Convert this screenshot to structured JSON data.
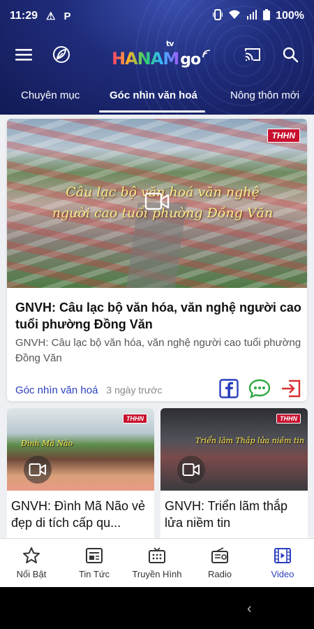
{
  "status_bar": {
    "time": "11:29",
    "battery": "100%",
    "icons_left": [
      "warning-icon",
      "parking-icon"
    ],
    "icons_right": [
      "vibrate-icon",
      "wifi-icon",
      "signal-icon",
      "battery-icon"
    ]
  },
  "app_bar": {
    "logo_hanam": "HANAM",
    "logo_tv": "tv",
    "logo_go": "go",
    "icons": [
      "menu-icon",
      "leaf-icon",
      "cast-icon",
      "search-icon"
    ]
  },
  "tabs": [
    {
      "label": "Chuyên mục",
      "active": false
    },
    {
      "label": "Góc nhìn văn hoá",
      "active": true
    },
    {
      "label": "Nông thôn mới",
      "active": false
    }
  ],
  "main_card": {
    "thumbnail_caption_line1": "Câu lạc bộ văn hoá văn nghệ",
    "thumbnail_caption_line2": "người cao tuổi phường Đồng Văn",
    "badge": "THHN",
    "title": "GNVH: Câu lạc bộ văn hóa, văn nghệ người cao tuổi phường Đồng Văn",
    "description": "GNVH: Câu lạc bộ văn hóa, văn nghệ người cao tuổi phường Đồng Văn",
    "category": "Góc nhìn văn hoá",
    "time": "3 ngày trước",
    "share_icons": [
      "facebook-icon",
      "chat-icon",
      "share-out-icon"
    ]
  },
  "small_cards": [
    {
      "title": "GNVH: Đình Mã Não vẻ đẹp di tích cấp qu...",
      "badge": "THHN",
      "caption": "Đình Mã Não"
    },
    {
      "title": "GNVH: Triển lãm thắp lửa niềm tin",
      "badge": "THHN",
      "caption": "Triển lãm Thắp lửa niềm tin"
    }
  ],
  "bottom_nav": [
    {
      "label": "Nổi Bật",
      "icon": "star-icon",
      "active": false
    },
    {
      "label": "Tin Tức",
      "icon": "news-icon",
      "active": false
    },
    {
      "label": "Truyền Hình",
      "icon": "tv-icon",
      "active": false
    },
    {
      "label": "Radio",
      "icon": "radio-icon",
      "active": false
    },
    {
      "label": "Video",
      "icon": "video-icon",
      "active": true
    }
  ],
  "colors": {
    "header_dark": "#121a55",
    "accent": "#2b3fbe",
    "badge_red": "#c8102e",
    "caption_yellow": "#f6f08a",
    "facebook_blue": "#2b3fbe",
    "chat_green": "#2fa845",
    "share_red": "#d93030"
  }
}
